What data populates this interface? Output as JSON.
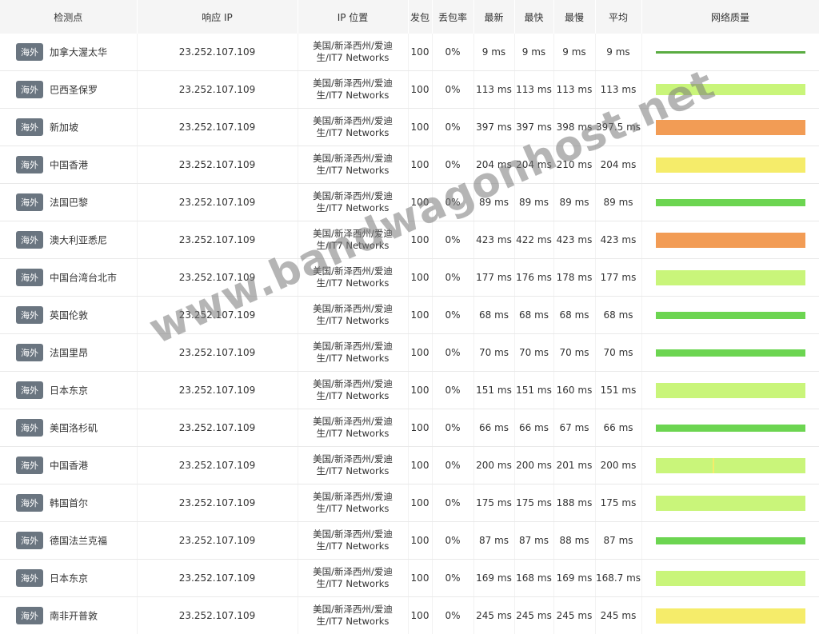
{
  "headers": [
    "检测点",
    "响应 IP",
    "IP 位置",
    "发包",
    "丢包率",
    "最新",
    "最快",
    "最慢",
    "平均",
    "网络质量"
  ],
  "watermark": "www.bandwagonhost.net",
  "colors": {
    "dark_green": "#5aac42",
    "green": "#6cd551",
    "light_green": "#c9f57a",
    "yellow": "#f5ec6a",
    "orange": "#f29c55",
    "badge": "#6a7580"
  },
  "rows": [
    {
      "badge": "海外",
      "city": "加拿大渥太华",
      "ip": "23.252.107.109",
      "loc1": "美国/新泽西州/爱迪",
      "loc2": "生/IT7 Networks",
      "sent": "100",
      "loss": "0%",
      "last": "9 ms",
      "best": "9 ms",
      "worst": "9 ms",
      "avg": "9 ms",
      "quality": {
        "color": "dark_green",
        "level": "thin"
      }
    },
    {
      "badge": "海外",
      "city": "巴西圣保罗",
      "ip": "23.252.107.109",
      "loc1": "美国/新泽西州/爱迪",
      "loc2": "生/IT7 Networks",
      "sent": "100",
      "loss": "0%",
      "last": "113 ms",
      "best": "113 ms",
      "worst": "113 ms",
      "avg": "113 ms",
      "quality": {
        "color": "light_green",
        "level": "medium"
      }
    },
    {
      "badge": "海外",
      "city": "新加坡",
      "ip": "23.252.107.109",
      "loc1": "美国/新泽西州/爱迪",
      "loc2": "生/IT7 Networks",
      "sent": "100",
      "loss": "0%",
      "last": "397 ms",
      "best": "397 ms",
      "worst": "398 ms",
      "avg": "397.5 ms",
      "quality": {
        "color": "orange",
        "level": "full"
      }
    },
    {
      "badge": "海外",
      "city": "中国香港",
      "ip": "23.252.107.109",
      "loc1": "美国/新泽西州/爱迪",
      "loc2": "生/IT7 Networks",
      "sent": "100",
      "loss": "0%",
      "last": "204 ms",
      "best": "204 ms",
      "worst": "210 ms",
      "avg": "204 ms",
      "quality": {
        "color": "yellow",
        "level": "full"
      }
    },
    {
      "badge": "海外",
      "city": "法国巴黎",
      "ip": "23.252.107.109",
      "loc1": "美国/新泽西州/爱迪",
      "loc2": "生/IT7 Networks",
      "sent": "100",
      "loss": "0%",
      "last": "89 ms",
      "best": "89 ms",
      "worst": "89 ms",
      "avg": "89 ms",
      "quality": {
        "color": "green",
        "level": "small"
      }
    },
    {
      "badge": "海外",
      "city": "澳大利亚悉尼",
      "ip": "23.252.107.109",
      "loc1": "美国/新泽西州/爱迪",
      "loc2": "生/IT7 Networks",
      "sent": "100",
      "loss": "0%",
      "last": "423 ms",
      "best": "422 ms",
      "worst": "423 ms",
      "avg": "423 ms",
      "quality": {
        "color": "orange",
        "level": "full"
      }
    },
    {
      "badge": "海外",
      "city": "中国台湾台北市",
      "ip": "23.252.107.109",
      "loc1": "美国/新泽西州/爱迪",
      "loc2": "生/IT7 Networks",
      "sent": "100",
      "loss": "0%",
      "last": "177 ms",
      "best": "176 ms",
      "worst": "178 ms",
      "avg": "177 ms",
      "quality": {
        "color": "light_green",
        "level": "full"
      }
    },
    {
      "badge": "海外",
      "city": "英国伦敦",
      "ip": "23.252.107.109",
      "loc1": "美国/新泽西州/爱迪",
      "loc2": "生/IT7 Networks",
      "sent": "100",
      "loss": "0%",
      "last": "68 ms",
      "best": "68 ms",
      "worst": "68 ms",
      "avg": "68 ms",
      "quality": {
        "color": "green",
        "level": "small"
      }
    },
    {
      "badge": "海外",
      "city": "法国里昂",
      "ip": "23.252.107.109",
      "loc1": "美国/新泽西州/爱迪",
      "loc2": "生/IT7 Networks",
      "sent": "100",
      "loss": "0%",
      "last": "70 ms",
      "best": "70 ms",
      "worst": "70 ms",
      "avg": "70 ms",
      "quality": {
        "color": "green",
        "level": "small"
      }
    },
    {
      "badge": "海外",
      "city": "日本东京",
      "ip": "23.252.107.109",
      "loc1": "美国/新泽西州/爱迪",
      "loc2": "生/IT7 Networks",
      "sent": "100",
      "loss": "0%",
      "last": "151 ms",
      "best": "151 ms",
      "worst": "160 ms",
      "avg": "151 ms",
      "quality": {
        "color": "light_green",
        "level": "full"
      }
    },
    {
      "badge": "海外",
      "city": "美国洛杉矶",
      "ip": "23.252.107.109",
      "loc1": "美国/新泽西州/爱迪",
      "loc2": "生/IT7 Networks",
      "sent": "100",
      "loss": "0%",
      "last": "66 ms",
      "best": "66 ms",
      "worst": "67 ms",
      "avg": "66 ms",
      "quality": {
        "color": "green",
        "level": "small"
      }
    },
    {
      "badge": "海外",
      "city": "中国香港",
      "ip": "23.252.107.109",
      "loc1": "美国/新泽西州/爱迪",
      "loc2": "生/IT7 Networks",
      "sent": "100",
      "loss": "0%",
      "last": "200 ms",
      "best": "200 ms",
      "worst": "201 ms",
      "avg": "200 ms",
      "quality": {
        "color": "light_green",
        "level": "full",
        "marker": 0.38
      }
    },
    {
      "badge": "海外",
      "city": "韩国首尔",
      "ip": "23.252.107.109",
      "loc1": "美国/新泽西州/爱迪",
      "loc2": "生/IT7 Networks",
      "sent": "100",
      "loss": "0%",
      "last": "175 ms",
      "best": "175 ms",
      "worst": "188 ms",
      "avg": "175 ms",
      "quality": {
        "color": "light_green",
        "level": "full"
      }
    },
    {
      "badge": "海外",
      "city": "德国法兰克福",
      "ip": "23.252.107.109",
      "loc1": "美国/新泽西州/爱迪",
      "loc2": "生/IT7 Networks",
      "sent": "100",
      "loss": "0%",
      "last": "87 ms",
      "best": "87 ms",
      "worst": "88 ms",
      "avg": "87 ms",
      "quality": {
        "color": "green",
        "level": "small"
      }
    },
    {
      "badge": "海外",
      "city": "日本东京",
      "ip": "23.252.107.109",
      "loc1": "美国/新泽西州/爱迪",
      "loc2": "生/IT7 Networks",
      "sent": "100",
      "loss": "0%",
      "last": "169 ms",
      "best": "168 ms",
      "worst": "169 ms",
      "avg": "168.7 ms",
      "quality": {
        "color": "light_green",
        "level": "full"
      }
    },
    {
      "badge": "海外",
      "city": "南非开普敦",
      "ip": "23.252.107.109",
      "loc1": "美国/新泽西州/爱迪",
      "loc2": "生/IT7 Networks",
      "sent": "100",
      "loss": "0%",
      "last": "245 ms",
      "best": "245 ms",
      "worst": "245 ms",
      "avg": "245 ms",
      "quality": {
        "color": "yellow",
        "level": "full"
      }
    }
  ]
}
